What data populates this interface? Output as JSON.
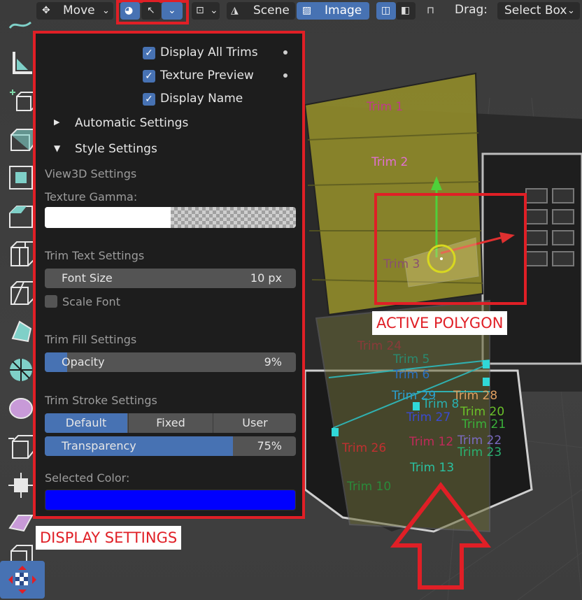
{
  "header": {
    "transform_tool": "Move",
    "scene_label": "Scene",
    "image_label": "Image",
    "drag_label": "Drag:",
    "drag_value": "Select Box"
  },
  "panel": {
    "checkboxes": [
      {
        "label": "Display All Trims",
        "checked": true
      },
      {
        "label": "Texture Preview",
        "checked": true
      },
      {
        "label": "Display Name",
        "checked": true
      }
    ],
    "automatic_settings": "Automatic Settings",
    "style_settings": "Style Settings",
    "view3d_settings": "View3D Settings",
    "texture_gamma": "Texture Gamma:",
    "texture_gamma_level": 0.5,
    "trim_text_settings": "Trim Text Settings",
    "font_size_label": "Font Size",
    "font_size_value": "10 px",
    "scale_font": "Scale Font",
    "trim_fill_settings": "Trim Fill Settings",
    "opacity_label": "Opacity",
    "opacity_value": "9%",
    "opacity_level": 0.09,
    "trim_stroke_settings": "Trim Stroke Settings",
    "stroke_modes": [
      "Default",
      "Fixed",
      "User"
    ],
    "stroke_selected": "Default",
    "transparency_label": "Transparency",
    "transparency_value": "75%",
    "transparency_level": 0.75,
    "selected_color_label": "Selected Color:",
    "selected_color": "#0000ff"
  },
  "annotations": {
    "display_settings": "DISPLAY SETTINGS",
    "active_polygon": "ACTIVE POLYGON",
    "accent": "#e01f26"
  },
  "trims": [
    {
      "name": "Trim 1",
      "color": "#c03a8a"
    },
    {
      "name": "Trim 2",
      "color": "#e070d0"
    },
    {
      "name": "Trim 3",
      "color": "#8a5070"
    },
    {
      "name": "Trim 24",
      "color": "#8a3a3a"
    },
    {
      "name": "Trim 5",
      "color": "#2a8a70"
    },
    {
      "name": "Trim 6",
      "color": "#2a70c0"
    },
    {
      "name": "Trim 29",
      "color": "#2aa0d0"
    },
    {
      "name": "Trim 28",
      "color": "#e0a060"
    },
    {
      "name": "Trim 8",
      "color": "#2ab0b0"
    },
    {
      "name": "Trim 20",
      "color": "#6ac02a"
    },
    {
      "name": "Trim 27",
      "color": "#3a4ad0"
    },
    {
      "name": "Trim 21",
      "color": "#3ab03a"
    },
    {
      "name": "Trim 12",
      "color": "#c02a5a"
    },
    {
      "name": "Trim 22",
      "color": "#7a6ac0"
    },
    {
      "name": "Trim 26",
      "color": "#c03030"
    },
    {
      "name": "Trim 23",
      "color": "#2ab070"
    },
    {
      "name": "Trim 13",
      "color": "#2ac0a0"
    },
    {
      "name": "Trim 10",
      "color": "#2a8a3a"
    }
  ]
}
